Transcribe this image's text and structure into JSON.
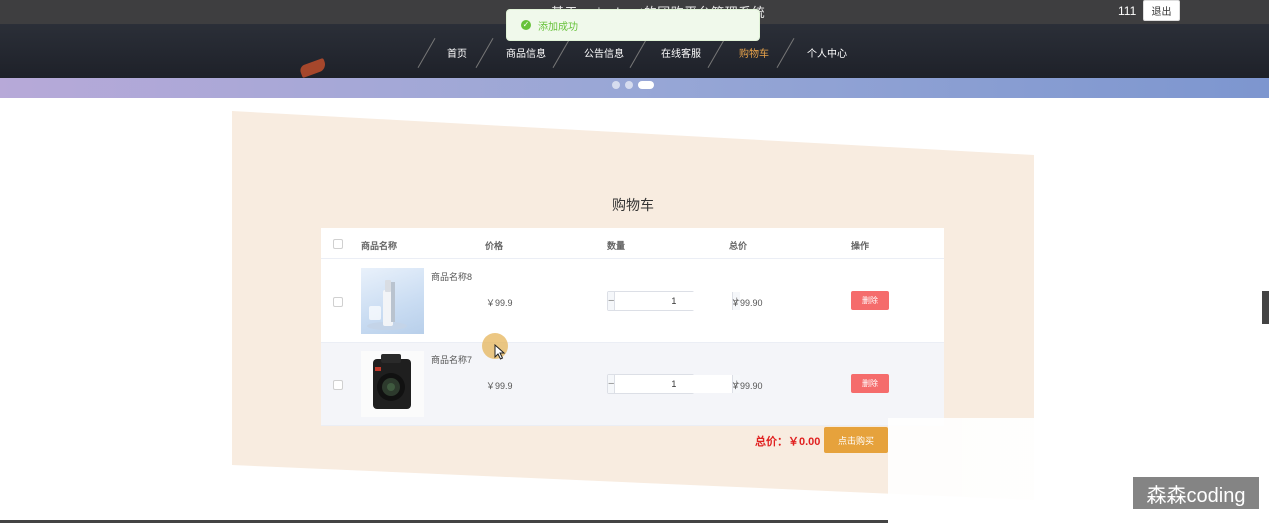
{
  "header": {
    "site_title": "基于springboot的团购平台管理系统",
    "user_name": "111",
    "logout_label": "退出"
  },
  "toast": {
    "icon": "check-circle-icon",
    "message": "添加成功",
    "color": "#67c23a"
  },
  "nav": {
    "items": [
      {
        "label": "首页"
      },
      {
        "label": "商品信息"
      },
      {
        "label": "公告信息"
      },
      {
        "label": "在线客服"
      },
      {
        "label": "购物车"
      },
      {
        "label": "个人中心"
      }
    ],
    "active_index": 4,
    "active_color": "#e8a34a"
  },
  "carousel": {
    "dot_count": 3,
    "active_dot": 3
  },
  "cart": {
    "title": "购物车",
    "columns": [
      "商品名称",
      "价格",
      "数量",
      "总价",
      "操作"
    ],
    "rows": [
      {
        "name": "商品名称8",
        "image": "perfume-bottle-product-image",
        "price": "￥99.9",
        "quantity": "1",
        "subtotal": "￥99.90",
        "action": "删除"
      },
      {
        "name": "商品名称7",
        "image": "camera-product-image",
        "price": "￥99.9",
        "quantity": "1",
        "subtotal": "￥99.90",
        "action": "删除"
      }
    ],
    "total_label": "总价：￥0.00",
    "buy_label": "点击购买"
  },
  "watermark": "森森coding",
  "colors": {
    "accent": "#e6a23c",
    "delete": "#f56c6c",
    "total": "#e02020",
    "beige_panel": "#f8ece0"
  }
}
